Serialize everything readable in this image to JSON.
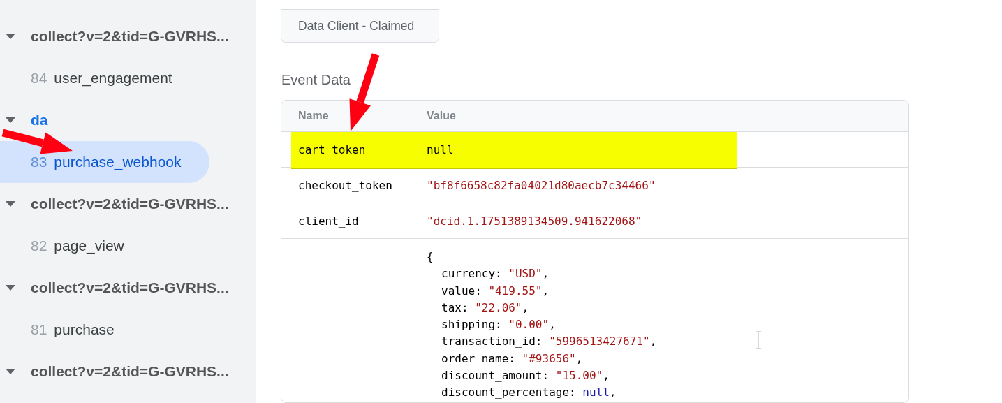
{
  "sidebar": {
    "items": [
      {
        "label": "collect?v=2&tid=G-GVRHS...",
        "expanded": true,
        "children": [
          {
            "number": "84",
            "label": "user_engagement",
            "selected": false
          }
        ]
      },
      {
        "label": "da",
        "expanded": true,
        "children": [
          {
            "number": "83",
            "label": "purchase_webhook",
            "selected": true
          }
        ]
      },
      {
        "label": "collect?v=2&tid=G-GVRHS...",
        "expanded": true,
        "children": [
          {
            "number": "82",
            "label": "page_view",
            "selected": false
          }
        ]
      },
      {
        "label": "collect?v=2&tid=G-GVRHS...",
        "expanded": true,
        "children": [
          {
            "number": "81",
            "label": "purchase",
            "selected": false
          }
        ]
      },
      {
        "label": "collect?v=2&tid=G-GVRHS...",
        "expanded": true
      }
    ]
  },
  "client_card": {
    "footer": "Data Client - Claimed"
  },
  "event_data": {
    "title": "Event Data",
    "columns": [
      "Name",
      "Value"
    ],
    "rows": [
      {
        "name": "cart_token",
        "value": "null",
        "kind": "null",
        "highlighted": true
      },
      {
        "name": "checkout_token",
        "value": "\"bf8f6658c82fa04021d80aecb7c34466\"",
        "kind": "string",
        "highlighted": false
      },
      {
        "name": "client_id",
        "value": "\"dcid.1.1751389134509.941622068\"",
        "kind": "string",
        "highlighted": false
      },
      {
        "name": "",
        "kind": "object",
        "highlighted": false,
        "open": "{",
        "entries": [
          {
            "key": "currency",
            "sep": ": ",
            "value": "\"USD\"",
            "kind": "string",
            "end": ","
          },
          {
            "key": "value",
            "sep": ": ",
            "value": "\"419.55\"",
            "kind": "string",
            "end": ","
          },
          {
            "key": "tax",
            "sep": ": ",
            "value": "\"22.06\"",
            "kind": "string",
            "end": ","
          },
          {
            "key": "shipping",
            "sep": ": ",
            "value": "\"0.00\"",
            "kind": "string",
            "end": ","
          },
          {
            "key": "transaction_id",
            "sep": ": ",
            "value": "\"5996513427671\"",
            "kind": "string",
            "end": ","
          },
          {
            "key": "order_name",
            "sep": ": ",
            "value": "\"#93656\"",
            "kind": "string",
            "end": ","
          },
          {
            "key": "discount_amount",
            "sep": ": ",
            "value": "\"15.00\"",
            "kind": "string",
            "end": ","
          },
          {
            "key": "discount_percentage",
            "sep": ": ",
            "value": "null",
            "kind": "keyword",
            "end": ","
          }
        ]
      }
    ]
  },
  "annotations": [
    {
      "kind": "arrow"
    },
    {
      "kind": "arrow"
    }
  ]
}
